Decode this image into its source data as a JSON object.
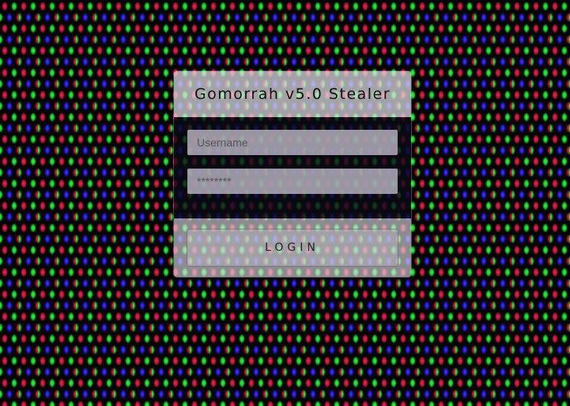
{
  "login": {
    "title": "Gomorrah v5.0 Stealer",
    "username_placeholder": "Username",
    "password_placeholder": "********",
    "login_label": "LOGIN"
  }
}
